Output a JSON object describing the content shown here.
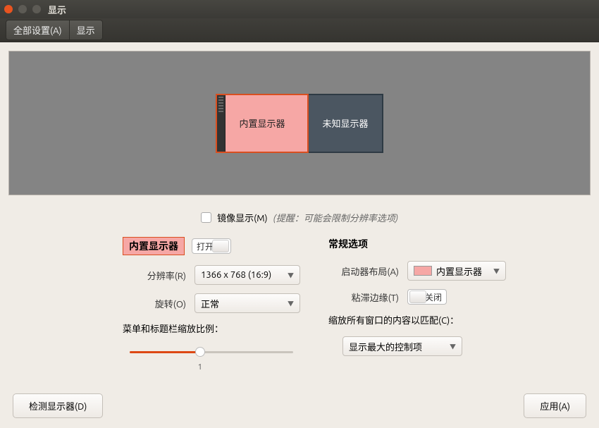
{
  "window": {
    "title": "显示"
  },
  "toolbar": {
    "all_settings": "全部设置(A)",
    "displays": "显示"
  },
  "preview": {
    "primary_label": "内置显示器",
    "secondary_label": "未知显示器"
  },
  "mirror": {
    "label": "镜像显示(M)",
    "note": "(提醒：可能会限制分辨率选项)"
  },
  "left": {
    "display_name": "内置显示器",
    "switch_state": "打开",
    "resolution_label": "分辨率(R)",
    "resolution_value": "1366 x 768 (16:9)",
    "rotation_label": "旋转(O)",
    "rotation_value": "正常",
    "scale_label": "菜单和标题栏缩放比例：",
    "scale_value": "1"
  },
  "right": {
    "section_title": "常规选项",
    "launcher_label": "启动器布局(A)",
    "launcher_value": "内置显示器",
    "sticky_label": "粘滞边缘(T)",
    "sticky_state": "关闭",
    "scale_all_label": "缩放所有窗口的内容以匹配(C)：",
    "scale_all_value": "显示最大的控制项"
  },
  "bottom": {
    "detect": "检测显示器(D)",
    "apply": "应用(A)"
  }
}
